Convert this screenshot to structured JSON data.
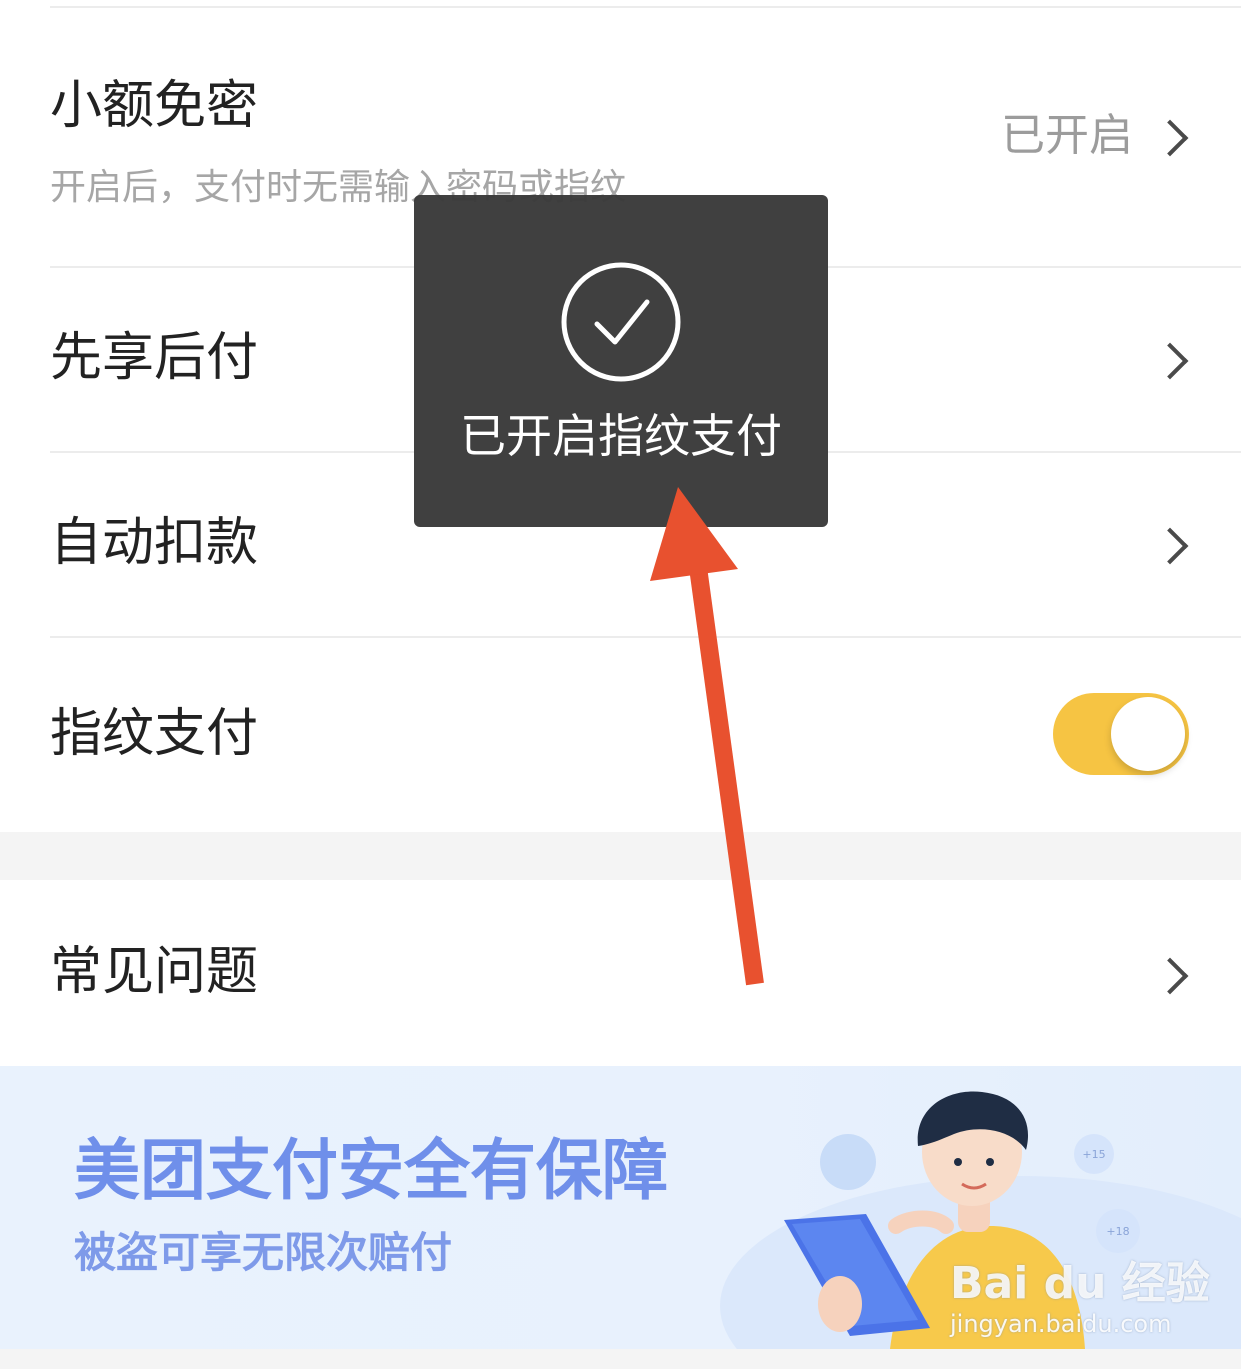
{
  "settings": {
    "rows": [
      {
        "title": "小额免密",
        "subtitle": "开启后，支付时无需输入密码或指纹",
        "value": "已开启"
      },
      {
        "title": "先享后付"
      },
      {
        "title": "自动扣款"
      },
      {
        "title": "指纹支付",
        "toggle_on": true
      }
    ],
    "faq": {
      "title": "常见问题"
    }
  },
  "banner": {
    "headline": "美团支付安全有保障",
    "subline": "被盗可享无限次赔付",
    "coin_labels": [
      "+15",
      "+18"
    ]
  },
  "toast": {
    "message": "已开启指纹支付",
    "icon": "check-circle-icon"
  },
  "watermark": {
    "brand": "Bai du 经验",
    "url": "jingyan.baidu.com"
  },
  "colors": {
    "toggle_on": "#f6c443",
    "toast_bg": "#3a3a3a",
    "arrow": "#e8512f",
    "banner_text": "#6f8fea"
  }
}
